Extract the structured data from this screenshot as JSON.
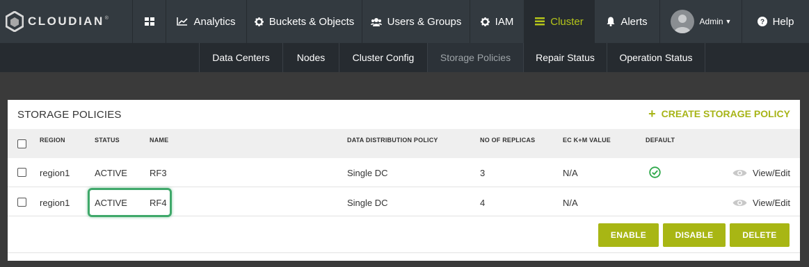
{
  "brand": {
    "name": "CLOUDIAN",
    "tm": "®"
  },
  "nav": {
    "analytics": "Analytics",
    "buckets": "Buckets & Objects",
    "users": "Users & Groups",
    "iam": "IAM",
    "cluster": "Cluster",
    "alerts": "Alerts",
    "admin": "Admin",
    "help": "Help"
  },
  "subnav": [
    "Data Centers",
    "Nodes",
    "Cluster Config",
    "Storage Policies",
    "Repair Status",
    "Operation Status"
  ],
  "panel": {
    "title": "STORAGE POLICIES",
    "create_label": "CREATE STORAGE POLICY"
  },
  "table": {
    "headers": [
      "REGION",
      "STATUS",
      "NAME",
      "DATA DISTRIBUTION POLICY",
      "NO OF REPLICAS",
      "EC K+M VALUE",
      "DEFAULT"
    ],
    "rows": [
      {
        "region": "region1",
        "status": "ACTIVE",
        "name": "RF3",
        "policy": "Single DC",
        "replicas": "3",
        "ec": "N/A",
        "default": true,
        "action": "View/Edit"
      },
      {
        "region": "region1",
        "status": "ACTIVE",
        "name": "RF4",
        "policy": "Single DC",
        "replicas": "4",
        "ec": "N/A",
        "default": false,
        "action": "View/Edit"
      }
    ]
  },
  "buttons": {
    "enable": "ENABLE",
    "disable": "DISABLE",
    "delete": "DELETE"
  },
  "colors": {
    "accent": "#a8b614",
    "nav_bg": "#333a40",
    "highlight": "#3fa86a"
  },
  "icons": [
    "cloudian-logo-icon",
    "dashboard-grid-icon",
    "chart-line-icon",
    "gear-icon",
    "users-icon",
    "cluster-stack-icon",
    "bell-icon",
    "avatar-icon",
    "help-circle-icon",
    "plus-icon",
    "check-circle-icon",
    "eye-icon"
  ]
}
